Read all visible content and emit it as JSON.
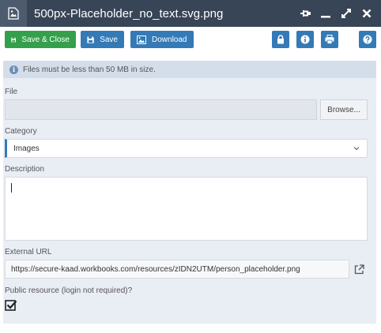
{
  "window": {
    "title": "500px-Placeholder_no_text.svg.png",
    "title_icon": "image-file-icon",
    "controls": [
      "pin-icon",
      "minimize-icon",
      "maximize-icon",
      "close-icon"
    ]
  },
  "toolbar": {
    "save_close_label": "Save & Close",
    "save_label": "Save",
    "download_label": "Download",
    "right_icons": [
      "lock-icon",
      "info-icon",
      "print-icon",
      "help-icon"
    ]
  },
  "form": {
    "info_message": "Files must be less than 50 MB in size.",
    "file_label": "File",
    "file_value": "",
    "browse_label": "Browse...",
    "category_label": "Category",
    "category_value": "Images",
    "description_label": "Description",
    "description_value": "",
    "external_url_label": "External URL",
    "external_url_value": "https://secure-kaad.workbooks.com/resources/zIDN2UTM/person_placeholder.png",
    "public_label": "Public resource (login not required)?",
    "public_checked": true
  },
  "colors": {
    "titlebar": "#384557",
    "accent_green": "#35a04b",
    "accent_blue": "#337ab7",
    "panel_bg": "#e9edf4",
    "info_bg": "#d4deeb"
  }
}
